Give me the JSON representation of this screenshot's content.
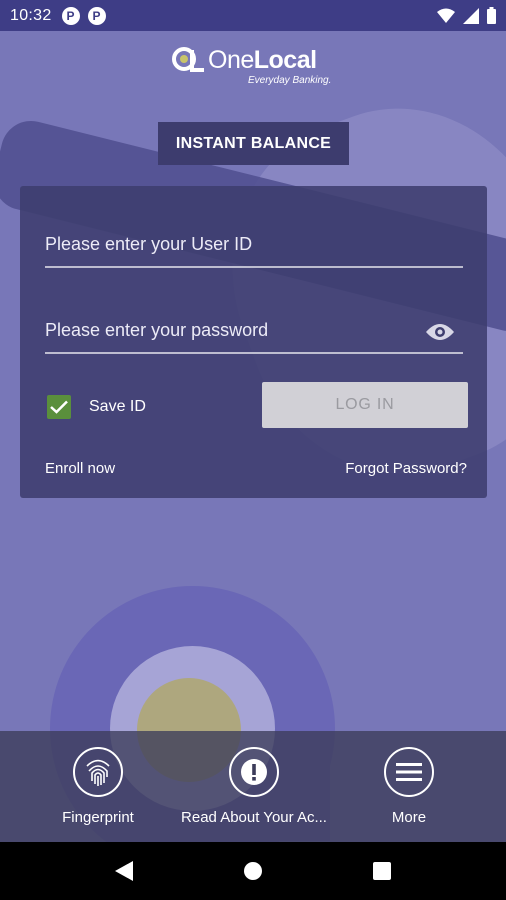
{
  "status_bar": {
    "time": "10:32",
    "notifications": [
      {
        "icon": "pandora-notification-icon",
        "letter": "P"
      },
      {
        "icon": "pandora-notification-icon",
        "letter": "P"
      }
    ],
    "system_icons": [
      "wifi-icon",
      "cellular-signal-icon",
      "battery-icon"
    ]
  },
  "logo": {
    "brand_regular": "One",
    "brand_bold": "Local",
    "tagline": "Everyday Banking."
  },
  "instant_balance": {
    "label": "INSTANT BALANCE"
  },
  "login_form": {
    "user_id": {
      "value": "",
      "placeholder": "Please enter your User ID"
    },
    "password": {
      "value": "",
      "placeholder": "Please enter your password"
    },
    "save_id": {
      "label": "Save ID",
      "checked": true
    },
    "login_button": "LOG IN",
    "enroll_link": "Enroll now",
    "forgot_link": "Forgot Password?"
  },
  "bottom_actions": [
    {
      "label": "Fingerprint",
      "icon": "fingerprint-icon"
    },
    {
      "label": "Read About Your Ac...",
      "icon": "exclamation-icon"
    },
    {
      "label": "More",
      "icon": "menu-icon"
    }
  ],
  "colors": {
    "status_bar": "#3e3d86",
    "background": "#7877b8",
    "card": "#3e3d6e",
    "checkbox": "#5a8f3c",
    "login_button": "#d1d0d6"
  }
}
